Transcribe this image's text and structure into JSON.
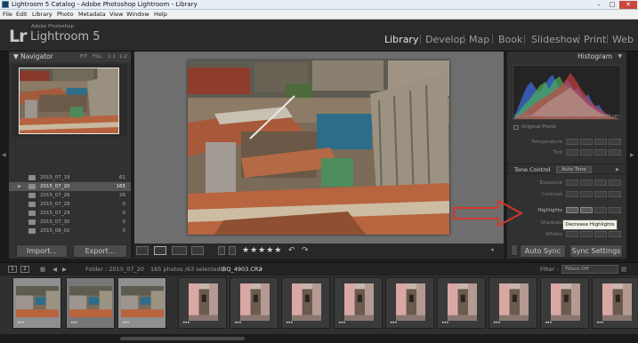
{
  "window": {
    "title": "Lightroom 5 Catalog - Adobe Photoshop Lightroom - Library",
    "minimize_glyph": "–",
    "maximize_glyph": "□",
    "close_glyph": "✕"
  },
  "menu": [
    "File",
    "Edit",
    "Library",
    "Photo",
    "Metadata",
    "View",
    "Window",
    "Help"
  ],
  "identity": {
    "logo": "Lr",
    "subtitle": "Adobe Photoshop",
    "product": "Lightroom 5"
  },
  "modules": [
    "Library",
    "Develop",
    "Map",
    "Book",
    "Slideshow",
    "Print",
    "Web"
  ],
  "active_module": "Library",
  "navigator": {
    "title": "Navigator",
    "zoom_options": [
      "FIT",
      "FILL",
      "1:1",
      "1:2"
    ]
  },
  "folders": [
    {
      "name": "2015_07_19",
      "count": "61"
    },
    {
      "name": "2015_07_20",
      "count": "165",
      "selected": true
    },
    {
      "name": "2015_07_26",
      "count": "26"
    },
    {
      "name": "2015_07_28",
      "count": "0"
    },
    {
      "name": "2015_07_29",
      "count": "0"
    },
    {
      "name": "2015_07_30",
      "count": "0"
    },
    {
      "name": "2015_08_02",
      "count": "0"
    }
  ],
  "left_buttons": {
    "import": "Import...",
    "export": "Export..."
  },
  "toolbar": {
    "stars": "★★★★★",
    "rotate_left": "↶",
    "rotate_right": "↷",
    "menu_caret": "▾"
  },
  "histogram": {
    "title": "Histogram",
    "iso": "ISO 640",
    "focal": "115 mm",
    "aperture": "f / 6.3",
    "shutter": "1/200 sec",
    "original_label": "Original Photo"
  },
  "develop": {
    "upper_rows": [
      "Temperature",
      "Tint"
    ],
    "tone_control": "Tone Control",
    "auto_tone": "Auto Tone",
    "rows": [
      "Exposure",
      "Contrast",
      "Highlights",
      "Shadows",
      "Whites"
    ],
    "tooltip": "Decrease Highlights"
  },
  "right_buttons": {
    "sync": "Auto Sync",
    "settings": "Sync Settings"
  },
  "stripbar": {
    "page1": "1",
    "page2": "2",
    "folder": "Folder : 2015_07_20",
    "count": "165 photos /63 selected /",
    "file": "IBQ_4903.CR2",
    "filter_label": "Filter :",
    "filter_value": "Filters Off"
  },
  "filmstrip": {
    "dots": "•••",
    "cells": [
      {
        "type": "wide",
        "state": "sel"
      },
      {
        "type": "wide",
        "state": "selm"
      },
      {
        "type": "wide",
        "state": "sel"
      },
      {
        "type": "tall",
        "state": "norm"
      },
      {
        "type": "tall",
        "state": "norm"
      },
      {
        "type": "tall",
        "state": "norm"
      },
      {
        "type": "tall",
        "state": "norm"
      },
      {
        "type": "tall",
        "state": "norm"
      },
      {
        "type": "tall",
        "state": "norm"
      },
      {
        "type": "tall",
        "state": "norm"
      },
      {
        "type": "tall",
        "state": "norm"
      },
      {
        "type": "tall",
        "state": "norm"
      }
    ]
  },
  "colors": {
    "accent_red_arrow": "#d23a2a",
    "panel_bg": "#313131",
    "center_bg": "#6e6e6e"
  }
}
